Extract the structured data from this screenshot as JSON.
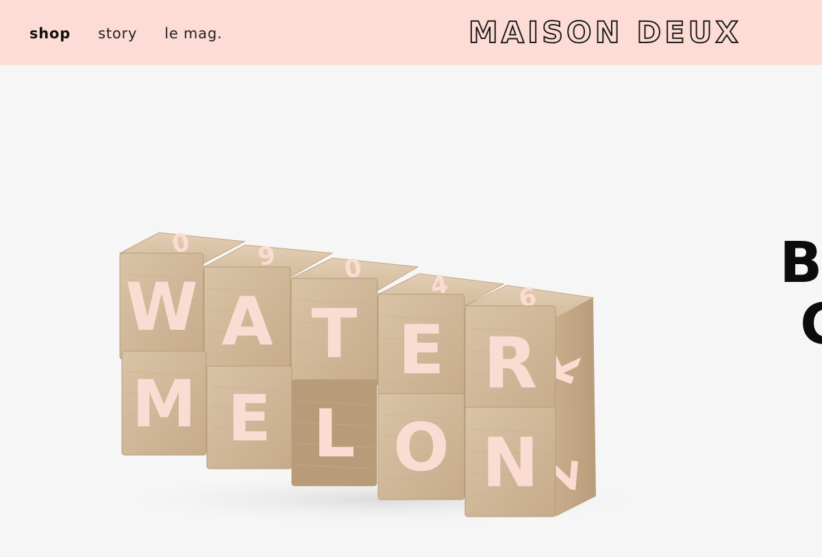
{
  "nav": {
    "links": [
      {
        "label": "shop",
        "active": true
      },
      {
        "label": "story",
        "active": false
      },
      {
        "label": "le mag.",
        "active": false
      }
    ]
  },
  "brand": {
    "logo_text": "MAISON DEUX"
  },
  "hero": {
    "heading_line1": "B",
    "heading_line2": "C",
    "image": {
      "alt": "wooden letter blocks",
      "top_row_letters": [
        "W",
        "A",
        "T",
        "E",
        "R"
      ],
      "bottom_row_letters": [
        "M",
        "E",
        "L",
        "O",
        "N"
      ],
      "top_face_digits": [
        "0",
        "9",
        "0",
        "4",
        "6"
      ],
      "side_letters": [
        "K",
        "Z"
      ]
    }
  },
  "colors": {
    "header_bg": "#fcdcd4",
    "page_bg": "#f6f6f6",
    "block_wood": "#d5bd9f",
    "block_letter": "#fbdcd3",
    "text_dark": "#111111"
  }
}
